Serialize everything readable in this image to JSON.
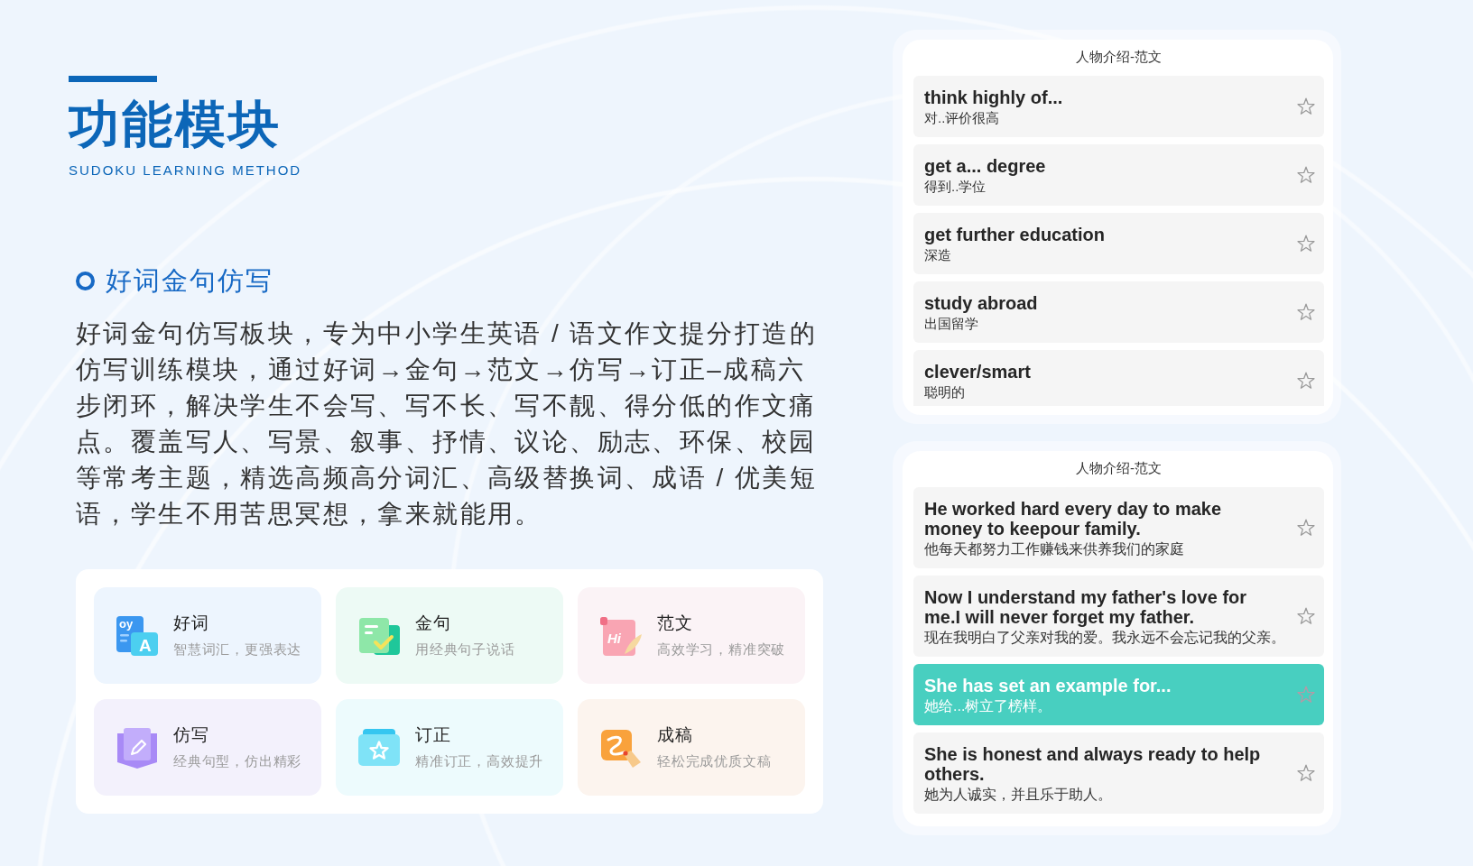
{
  "header": {
    "title": "功能模块",
    "subtitle": "SUDOKU LEARNING METHOD"
  },
  "section": {
    "heading": "好词金句仿写",
    "description": "好词金句仿写板块，专为中小学生英语 / 语文作文提分打造的仿写训练模块，通过好词→金句→范文→仿写→订正–成稿六步闭环，解决学生不会写、写不长、写不靓、得分低的作文痛点。覆盖写人、写景、叙事、抒情、议论、励志、环保、校园等常考主题，精选高频高分词汇、高级替换词、成语 / 优美短语，学生不用苦思冥想，拿来就能用。"
  },
  "modules": [
    {
      "title": "好词",
      "subtitle": "智慧词汇，更强表达",
      "icon_text": [
        "oy",
        "A"
      ]
    },
    {
      "title": "金句",
      "subtitle": "用经典句子说话"
    },
    {
      "title": "范文",
      "subtitle": "高效学习，精准突破",
      "icon_text": [
        "Hi"
      ]
    },
    {
      "title": "仿写",
      "subtitle": "经典句型，仿出精彩"
    },
    {
      "title": "订正",
      "subtitle": "精准订正，高效提升"
    },
    {
      "title": "成稿",
      "subtitle": "轻松完成优质文稿"
    }
  ],
  "phrase_panel": {
    "title": "人物介绍-范文",
    "items": [
      {
        "english": "think highly of...",
        "chinese": "对..评价很高",
        "selected": false
      },
      {
        "english": "get a... degree",
        "chinese": "得到..学位",
        "selected": false
      },
      {
        "english": "get further education",
        "chinese": "深造",
        "selected": false
      },
      {
        "english": "study abroad",
        "chinese": "出国留学",
        "selected": false
      },
      {
        "english": "clever/smart",
        "chinese": "聪明的",
        "selected": false
      }
    ]
  },
  "sentence_panel": {
    "title": "人物介绍-范文",
    "items": [
      {
        "english": "He worked hard every day to make money to keepour family.",
        "chinese": "他每天都努力工作赚钱来供养我们的家庭",
        "selected": false
      },
      {
        "english": "Now I understand my father's love for me.I will never forget my father.",
        "chinese": "现在我明白了父亲对我的爱。我永远不会忘记我的父亲。",
        "selected": false
      },
      {
        "english": "She has set an example for...",
        "chinese": "她给...树立了榜样。",
        "selected": true
      },
      {
        "english": "She is honest and always ready to help others.",
        "chinese": "她为人诚实，并且乐于助人。",
        "selected": false
      }
    ]
  }
}
